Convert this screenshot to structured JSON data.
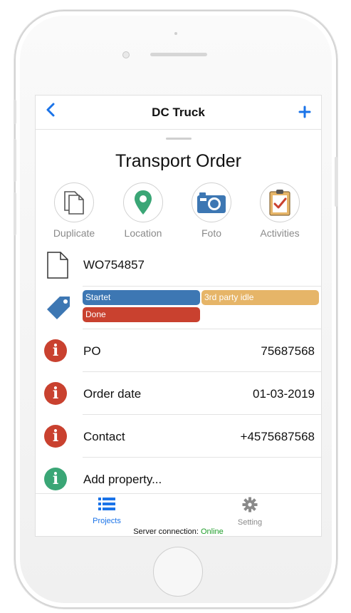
{
  "nav": {
    "back_icon": "chevron-left-icon",
    "title": "DC Truck",
    "add_icon": "plus-icon"
  },
  "page": {
    "title": "Transport Order"
  },
  "actions": [
    {
      "label": "Duplicate",
      "icon": "duplicate-icon"
    },
    {
      "label": "Location",
      "icon": "location-pin-icon"
    },
    {
      "label": "Foto",
      "icon": "camera-icon"
    },
    {
      "label": "Activities",
      "icon": "clipboard-check-icon"
    }
  ],
  "order": {
    "number": "WO754857"
  },
  "tags": [
    {
      "label": "Startet",
      "color": "#3d77b3"
    },
    {
      "label": "3rd party idle",
      "color": "#e6b568"
    },
    {
      "label": "Done",
      "color": "#c9412f"
    }
  ],
  "properties": [
    {
      "key": "PO",
      "value": "75687568",
      "color": "#c9412f"
    },
    {
      "key": "Order date",
      "value": "01-03-2019",
      "color": "#c9412f"
    },
    {
      "key": "Contact",
      "value": "+4575687568",
      "color": "#c9412f"
    },
    {
      "key": "Add property...",
      "value": "",
      "color": "#3aa676"
    }
  ],
  "tabbar": {
    "projects_label": "Projects",
    "setting_label": "Setting",
    "active_color": "#1a73e8",
    "inactive_color": "#8a8a8a"
  },
  "status": {
    "prefix": "Server connection:",
    "state": "Online"
  }
}
